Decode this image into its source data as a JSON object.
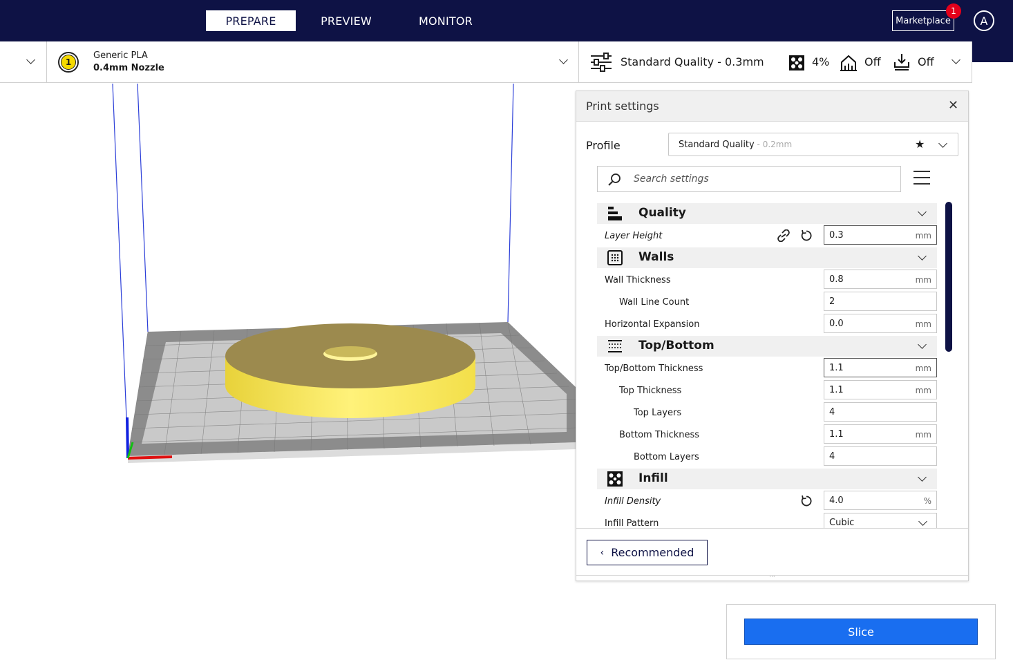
{
  "stages": {
    "prepare": "PREPARE",
    "preview": "PREVIEW",
    "monitor": "MONITOR"
  },
  "header": {
    "marketplace": "Marketplace",
    "marketplace_badge": "1",
    "account_initial": "A"
  },
  "extruder": {
    "number": "1",
    "material": "Generic PLA",
    "nozzle": "0.4mm Nozzle"
  },
  "quality_bar": {
    "profile": "Standard Quality - 0.3mm",
    "infill": "4%",
    "support": "Off",
    "adhesion": "Off"
  },
  "print_settings": {
    "title": "Print settings",
    "profile_label": "Profile",
    "profile_name": "Standard Quality",
    "profile_sub": " - 0.2mm",
    "search_placeholder": "Search settings",
    "recommended_label": "Recommended",
    "categories": {
      "quality": "Quality",
      "walls": "Walls",
      "topbottom": "Top/Bottom",
      "infill": "Infill"
    },
    "rows": {
      "layer_height": {
        "label": "Layer Height",
        "value": "0.3",
        "unit": "mm"
      },
      "wall_thickness": {
        "label": "Wall Thickness",
        "value": "0.8",
        "unit": "mm"
      },
      "wall_line_count": {
        "label": "Wall Line Count",
        "value": "2"
      },
      "horizontal_expansion": {
        "label": "Horizontal Expansion",
        "value": "0.0",
        "unit": "mm"
      },
      "topbottom_thickness": {
        "label": "Top/Bottom Thickness",
        "value": "1.1",
        "unit": "mm"
      },
      "top_thickness": {
        "label": "Top Thickness",
        "value": "1.1",
        "unit": "mm"
      },
      "top_layers": {
        "label": "Top Layers",
        "value": "4"
      },
      "bottom_thickness": {
        "label": "Bottom Thickness",
        "value": "1.1",
        "unit": "mm"
      },
      "bottom_layers": {
        "label": "Bottom Layers",
        "value": "4"
      },
      "infill_density": {
        "label": "Infill Density",
        "value": "4.0",
        "unit": "%"
      },
      "infill_pattern": {
        "label": "Infill Pattern",
        "value": "Cubic"
      }
    }
  },
  "slice": {
    "label": "Slice"
  },
  "colors": {
    "header_bg": "#0e1245",
    "accent_blue": "#196ef0",
    "model_yellow": "#f5e85a",
    "badge_red": "#e3001b"
  }
}
